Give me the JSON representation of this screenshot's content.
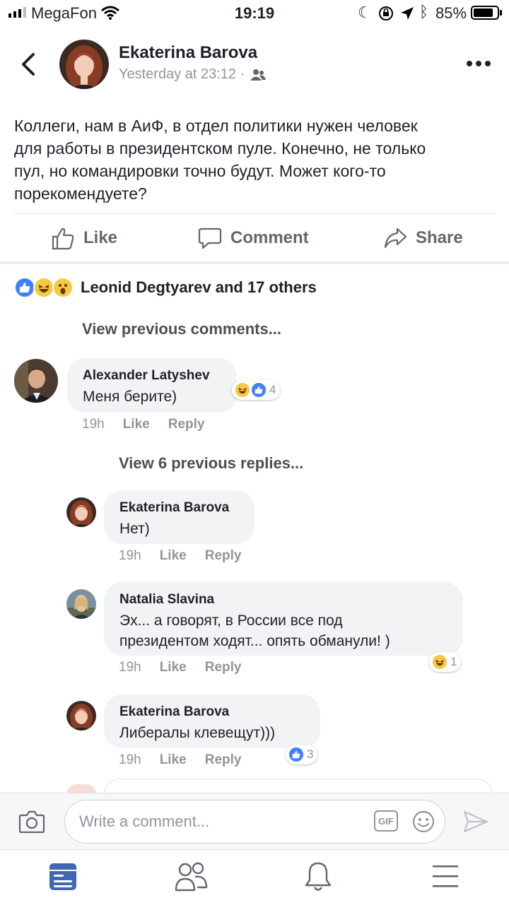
{
  "status": {
    "carrier": "MegaFon",
    "time": "19:19",
    "battery": "85%"
  },
  "post": {
    "author": "Ekaterina Barova",
    "time": "Yesterday at 23:12 ·",
    "text_lines": [
      "Коллеги, нам в АиФ, в отдел политики нужен человек",
      "для работы в президентском пуле. Конечно, не только",
      "пул, но командировки точно будут. Может кого-то",
      "порекомендуете?"
    ],
    "actions": {
      "like": "Like",
      "comment": "Comment",
      "share": "Share"
    },
    "reactions": {
      "names": "Leonid  Degtyarev and 17 others"
    },
    "view_previous_comments": "View previous comments..."
  },
  "comments": [
    {
      "author": "Alexander Latyshev",
      "text": "Меня берите)",
      "time": "19h",
      "like": "Like",
      "reply": "Reply",
      "reaction_count": "4"
    }
  ],
  "view_replies": "View 6 previous replies...",
  "replies": [
    {
      "author": "Ekaterina Barova",
      "text_lines": [
        "Нет)"
      ],
      "time": "19h",
      "like": "Like",
      "reply": "Reply",
      "reaction_count": ""
    },
    {
      "author": "Natalia Slavina",
      "text_lines": [
        "Эх... а говорят, в России все под",
        "президентом ходят... опять обманули! )"
      ],
      "time": "19h",
      "like": "Like",
      "reply": "Reply",
      "reaction_count": "1"
    },
    {
      "author": "Ekaterina Barova",
      "text_lines": [
        "Либералы клевещут)))"
      ],
      "time": "19h",
      "like": "Like",
      "reply": "Reply",
      "reaction_count": "3"
    }
  ],
  "composer": {
    "placeholder": "Write a comment...",
    "gif": "GIF"
  },
  "colors": {
    "accent": "#4267b2",
    "like_blue": "#4080ff",
    "gray_text": "#90949c",
    "bubble": "#f2f3f5"
  }
}
